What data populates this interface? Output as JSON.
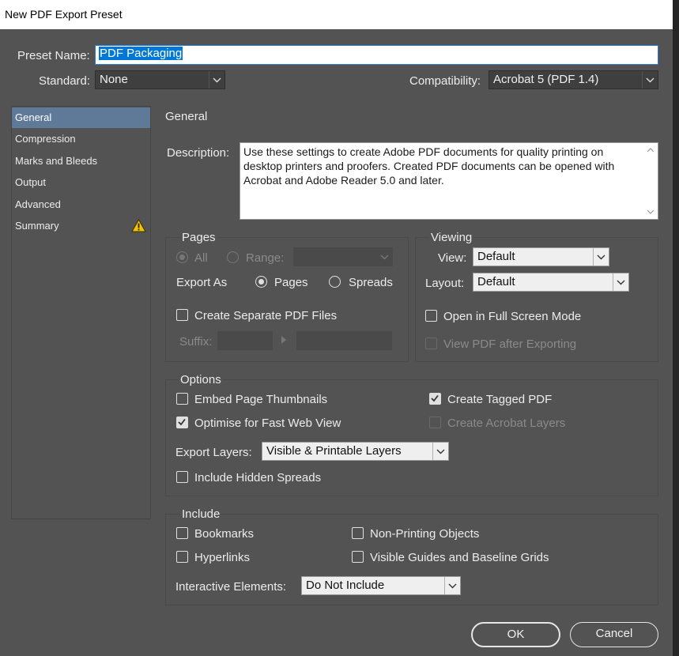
{
  "window": {
    "title": "New PDF Export Preset"
  },
  "preset_name": {
    "label": "Preset Name:",
    "value": "PDF Packaging"
  },
  "standard": {
    "label": "Standard:",
    "value": "None"
  },
  "compatibility": {
    "label": "Compatibility:",
    "value": "Acrobat 5 (PDF 1.4)"
  },
  "sidebar": {
    "items": [
      {
        "label": "General"
      },
      {
        "label": "Compression"
      },
      {
        "label": "Marks and Bleeds"
      },
      {
        "label": "Output"
      },
      {
        "label": "Advanced"
      },
      {
        "label": "Summary",
        "icon": "warning-icon"
      }
    ],
    "active": "General"
  },
  "section_title": "General",
  "description": {
    "label": "Description:",
    "text": "Use these settings to create Adobe PDF documents for quality printing on desktop printers and proofers.  Created PDF documents can be opened with Acrobat and Adobe Reader 5.0 and later."
  },
  "pages": {
    "title": "Pages",
    "all_label": "All",
    "range_label": "Range:",
    "export_as_label": "Export As",
    "pages_option": "Pages",
    "spreads_option": "Spreads",
    "create_separate_label": "Create Separate PDF Files",
    "suffix_label": "Suffix:"
  },
  "viewing": {
    "title": "Viewing",
    "view_label": "View:",
    "view_value": "Default",
    "layout_label": "Layout:",
    "layout_value": "Default",
    "full_screen_label": "Open in Full Screen Mode",
    "view_after_label": "View PDF after Exporting"
  },
  "options": {
    "title": "Options",
    "embed_thumbnails": "Embed Page Thumbnails",
    "optimise_web": "Optimise for Fast Web View",
    "create_tagged": "Create Tagged PDF",
    "create_acrobat_layers": "Create Acrobat Layers",
    "export_layers_label": "Export Layers:",
    "export_layers_value": "Visible & Printable Layers",
    "include_hidden": "Include Hidden Spreads"
  },
  "include": {
    "title": "Include",
    "bookmarks": "Bookmarks",
    "hyperlinks": "Hyperlinks",
    "non_printing": "Non-Printing Objects",
    "visible_guides": "Visible Guides and Baseline Grids",
    "interactive_label": "Interactive Elements:",
    "interactive_value": "Do Not Include"
  },
  "buttons": {
    "ok": "OK",
    "cancel": "Cancel"
  },
  "colors": {
    "panel_bg": "#535353",
    "active_item": "#5e7a98",
    "selection": "#0078d7",
    "warning": "#f2c400"
  }
}
